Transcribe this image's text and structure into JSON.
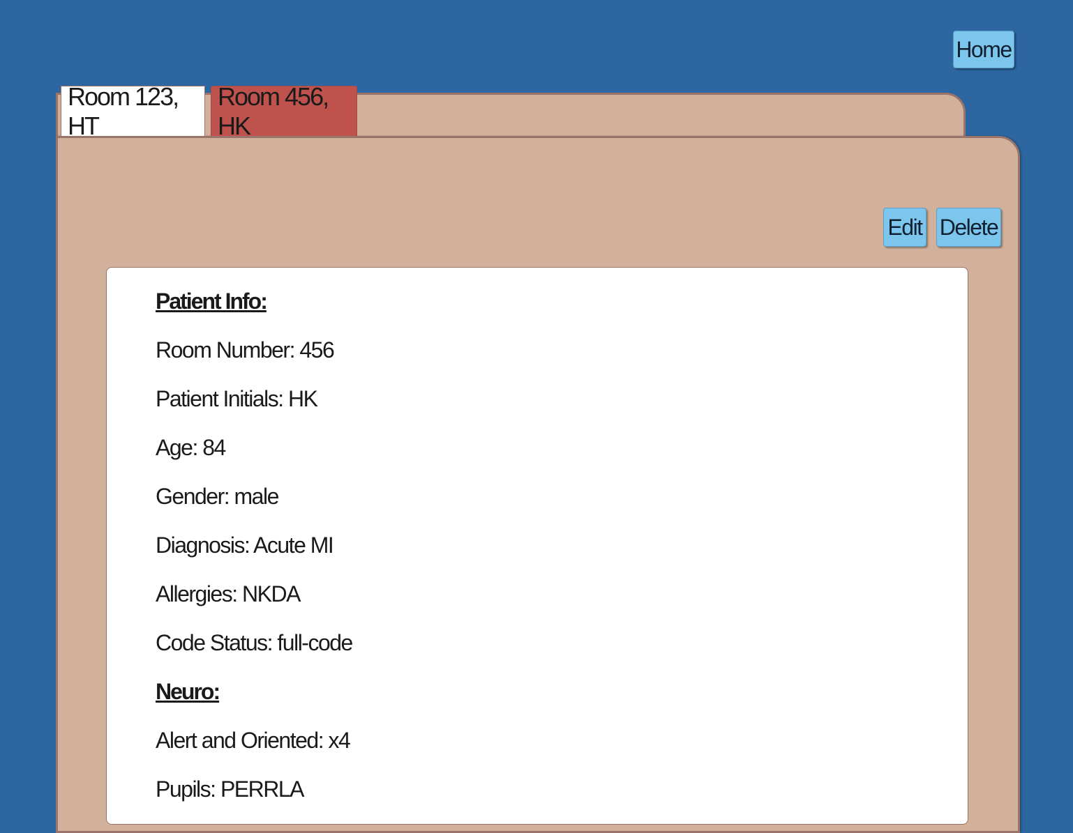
{
  "header": {
    "home_label": "Home"
  },
  "tabs": [
    {
      "label": "Room 123, HT",
      "active": true
    },
    {
      "label": "Room 456, HK",
      "active": false
    }
  ],
  "actions": {
    "edit_label": "Edit",
    "delete_label": "Delete"
  },
  "patient_info": {
    "heading": "Patient Info:",
    "room_number": "Room Number: 456",
    "initials": "Patient Initials: HK",
    "age": "Age: 84",
    "gender": "Gender: male",
    "diagnosis": "Diagnosis: Acute MI",
    "allergies": "Allergies: NKDA",
    "code_status": "Code Status: full-code"
  },
  "neuro": {
    "heading": "Neuro:",
    "alert_oriented": "Alert and Oriented: x4",
    "pupils": "Pupils: PERRLA"
  },
  "colors": {
    "background": "#2d66a0",
    "folder": "#d2b19c",
    "button": "#7cc5ec",
    "tab_highlight": "#c0524e"
  }
}
